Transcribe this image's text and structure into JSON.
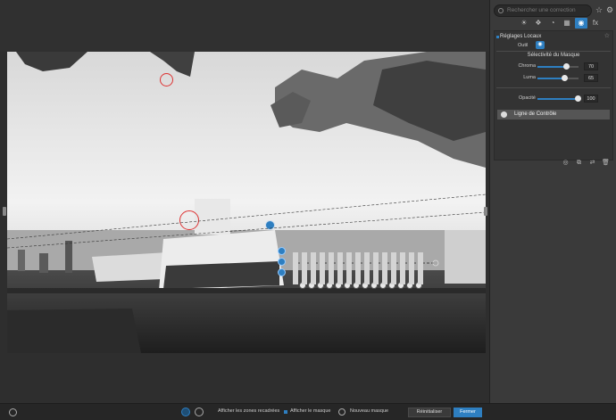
{
  "search": {
    "placeholder": "Rechercher une correction"
  },
  "panel": {
    "tabs": [
      "sun-icon",
      "palette-icon",
      "timer-icon",
      "grid-icon",
      "target-icon",
      "fx-icon"
    ],
    "tab_fx_label": "fx",
    "section_title": "Réglages Locaux",
    "outil_label": "Outil",
    "mask_title": "Sélectivité du Masque",
    "sliders": [
      {
        "label": "Chroma",
        "value": "70",
        "fraction": 0.7
      },
      {
        "label": "Luma",
        "value": "65",
        "fraction": 0.65
      },
      {
        "label": "Opacité",
        "value": "100",
        "fraction": 1.0
      }
    ],
    "control_line_label": "Ligne de Contrôle"
  },
  "bottombar": {
    "show_crop": "Afficher les zones recadrées",
    "show_mask": "Afficher le masque",
    "new_mask": "Nouveau masque",
    "reset": "Réinitialiser",
    "close": "Fermer"
  },
  "colors": {
    "accent": "#2e7fc1",
    "panel_bg": "#3a3a3a",
    "bar_bg": "#262626"
  }
}
